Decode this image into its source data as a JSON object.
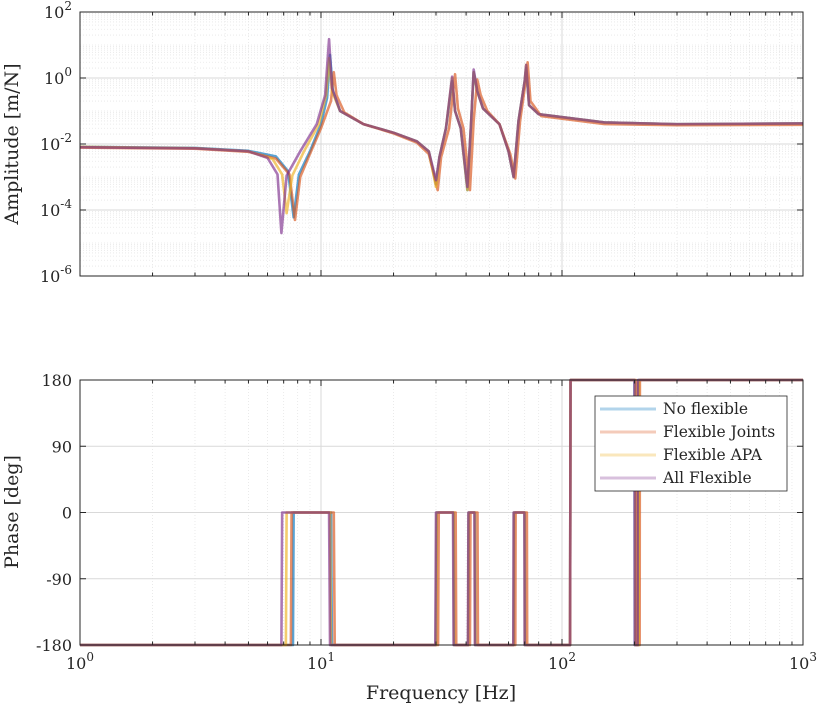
{
  "chart_data": [
    {
      "type": "line",
      "panel": "magnitude",
      "ylabel": "Amplitude [m/N]",
      "xlabel": "",
      "xscale": "log",
      "yscale": "log",
      "xlim": [
        1,
        1000
      ],
      "ylim": [
        1e-06,
        100
      ],
      "grid": true,
      "y_tick_labels": [
        {
          "base": "10",
          "exp": "2"
        },
        {
          "base": "10",
          "exp": "0"
        },
        {
          "base": "10",
          "exp": "-2"
        },
        {
          "base": "10",
          "exp": "-4"
        },
        {
          "base": "10",
          "exp": "-6"
        }
      ],
      "series": [
        {
          "name": "No flexible",
          "color": "#0072BD",
          "points": [
            [
              1,
              0.0082
            ],
            [
              3,
              0.0076
            ],
            [
              5,
              0.0062
            ],
            [
              6.5,
              0.0042
            ],
            [
              7.3,
              0.0015
            ],
            [
              7.7,
              6e-05
            ],
            [
              8.1,
              0.0012
            ],
            [
              9,
              0.006
            ],
            [
              10,
              0.04
            ],
            [
              10.6,
              0.25
            ],
            [
              10.9,
              5
            ],
            [
              11.2,
              0.4
            ],
            [
              12,
              0.1
            ],
            [
              15,
              0.04
            ],
            [
              20,
              0.022
            ],
            [
              25,
              0.012
            ],
            [
              28,
              0.006
            ],
            [
              30,
              0.0006
            ],
            [
              31,
              0.004
            ],
            [
              33,
              0.03
            ],
            [
              35,
              0.8
            ],
            [
              36,
              0.1
            ],
            [
              38,
              0.03
            ],
            [
              40.5,
              0.0004
            ],
            [
              42,
              0.05
            ],
            [
              43,
              1.5
            ],
            [
              44.5,
              0.4
            ],
            [
              47,
              0.12
            ],
            [
              55,
              0.04
            ],
            [
              60,
              0.006
            ],
            [
              63,
              0.001
            ],
            [
              66,
              0.05
            ],
            [
              70,
              0.8
            ],
            [
              71,
              2
            ],
            [
              73,
              0.15
            ],
            [
              80,
              0.08
            ],
            [
              150,
              0.045
            ],
            [
              300,
              0.04
            ],
            [
              1000,
              0.042
            ]
          ]
        },
        {
          "name": "Flexible Joints",
          "color": "#D95319",
          "points": [
            [
              1,
              0.0078
            ],
            [
              3,
              0.0072
            ],
            [
              5,
              0.0058
            ],
            [
              6.5,
              0.0036
            ],
            [
              7.4,
              0.0012
            ],
            [
              7.8,
              5e-05
            ],
            [
              8.2,
              0.001
            ],
            [
              9,
              0.005
            ],
            [
              10,
              0.03
            ],
            [
              11,
              0.2
            ],
            [
              11.3,
              1.5
            ],
            [
              11.6,
              0.3
            ],
            [
              12.5,
              0.09
            ],
            [
              15,
              0.04
            ],
            [
              20,
              0.021
            ],
            [
              25,
              0.011
            ],
            [
              28,
              0.005
            ],
            [
              30.5,
              0.0004
            ],
            [
              31.5,
              0.004
            ],
            [
              34,
              0.03
            ],
            [
              36,
              1.3
            ],
            [
              37,
              0.12
            ],
            [
              39,
              0.03
            ],
            [
              41.5,
              0.0004
            ],
            [
              43,
              0.05
            ],
            [
              44.5,
              0.9
            ],
            [
              46,
              0.3
            ],
            [
              49,
              0.1
            ],
            [
              55,
              0.04
            ],
            [
              61,
              0.005
            ],
            [
              64,
              0.0009
            ],
            [
              67,
              0.05
            ],
            [
              71,
              1
            ],
            [
              72,
              3
            ],
            [
              74,
              0.2
            ],
            [
              82,
              0.07
            ],
            [
              150,
              0.04
            ],
            [
              300,
              0.037
            ],
            [
              1000,
              0.038
            ]
          ]
        },
        {
          "name": "Flexible APA",
          "color": "#EDB120",
          "points": [
            [
              1,
              0.0082
            ],
            [
              3,
              0.0075
            ],
            [
              5,
              0.006
            ],
            [
              6.3,
              0.0035
            ],
            [
              6.9,
              0.0012
            ],
            [
              7.2,
              8e-05
            ],
            [
              7.6,
              0.0011
            ],
            [
              8.5,
              0.006
            ],
            [
              9.8,
              0.04
            ],
            [
              10.5,
              0.3
            ],
            [
              10.8,
              4
            ],
            [
              11.1,
              0.4
            ],
            [
              12,
              0.1
            ],
            [
              15,
              0.04
            ],
            [
              20,
              0.022
            ],
            [
              25,
              0.012
            ],
            [
              28,
              0.006
            ],
            [
              30,
              0.0005
            ],
            [
              31,
              0.004
            ],
            [
              33,
              0.03
            ],
            [
              35,
              1
            ],
            [
              36,
              0.1
            ],
            [
              38,
              0.03
            ],
            [
              40.5,
              0.0004
            ],
            [
              42,
              0.05
            ],
            [
              43,
              1.5
            ],
            [
              44.5,
              0.4
            ],
            [
              47,
              0.12
            ],
            [
              55,
              0.04
            ],
            [
              60,
              0.006
            ],
            [
              63,
              0.001
            ],
            [
              66,
              0.05
            ],
            [
              70,
              0.8
            ],
            [
              71,
              2.5
            ],
            [
              73,
              0.15
            ],
            [
              80,
              0.08
            ],
            [
              150,
              0.045
            ],
            [
              300,
              0.04
            ],
            [
              1000,
              0.042
            ]
          ]
        },
        {
          "name": "All Flexible",
          "color": "#7E2F8E",
          "points": [
            [
              1,
              0.008
            ],
            [
              3,
              0.0074
            ],
            [
              5,
              0.006
            ],
            [
              6,
              0.0038
            ],
            [
              6.6,
              0.0012
            ],
            [
              6.85,
              2e-05
            ],
            [
              7.2,
              0.0011
            ],
            [
              8.2,
              0.006
            ],
            [
              9.6,
              0.04
            ],
            [
              10.4,
              0.3
            ],
            [
              10.8,
              15
            ],
            [
              11.1,
              0.5
            ],
            [
              12,
              0.1
            ],
            [
              15,
              0.04
            ],
            [
              20,
              0.022
            ],
            [
              25,
              0.012
            ],
            [
              28,
              0.006
            ],
            [
              30,
              0.0008
            ],
            [
              31,
              0.004
            ],
            [
              33,
              0.03
            ],
            [
              35,
              1.1
            ],
            [
              36,
              0.1
            ],
            [
              38,
              0.03
            ],
            [
              40.5,
              0.0005
            ],
            [
              42,
              0.05
            ],
            [
              43,
              1.8
            ],
            [
              44.5,
              0.4
            ],
            [
              47,
              0.12
            ],
            [
              55,
              0.04
            ],
            [
              60,
              0.006
            ],
            [
              63,
              0.001
            ],
            [
              66,
              0.05
            ],
            [
              70,
              0.8
            ],
            [
              71,
              2.5
            ],
            [
              73,
              0.15
            ],
            [
              80,
              0.08
            ],
            [
              150,
              0.045
            ],
            [
              300,
              0.04
            ],
            [
              1000,
              0.042
            ]
          ]
        }
      ]
    },
    {
      "type": "line",
      "panel": "phase",
      "ylabel": "Phase [deg]",
      "xlabel": "Frequency [Hz]",
      "xscale": "log",
      "xlim": [
        1,
        1000
      ],
      "ylim": [
        -180,
        180
      ],
      "yticks": [
        180,
        90,
        0,
        -90,
        -180
      ],
      "y_tick_labels": [
        "180",
        "90",
        "0",
        "-90",
        "-180"
      ],
      "x_tick_labels": [
        {
          "base": "10",
          "exp": "0"
        },
        {
          "base": "10",
          "exp": "1"
        },
        {
          "base": "10",
          "exp": "2"
        },
        {
          "base": "10",
          "exp": "3"
        }
      ],
      "grid": true,
      "legend": "top-right",
      "series": [
        {
          "name": "No flexible",
          "color": "#0072BD",
          "points": [
            [
              1,
              -180
            ],
            [
              7.65,
              -180
            ],
            [
              7.7,
              0
            ],
            [
              11,
              0
            ],
            [
              11.1,
              -180
            ],
            [
              30,
              -180
            ],
            [
              30.2,
              0
            ],
            [
              35.5,
              0
            ],
            [
              35.7,
              -180
            ],
            [
              40.8,
              -180
            ],
            [
              41,
              0
            ],
            [
              43.5,
              0
            ],
            [
              43.7,
              -180
            ],
            [
              63,
              -180
            ],
            [
              63.2,
              0
            ],
            [
              70,
              0
            ],
            [
              70.2,
              -180
            ],
            [
              108,
              -180
            ],
            [
              108.5,
              180
            ],
            [
              200,
              180
            ],
            [
              200.5,
              -180
            ],
            [
              207,
              -180
            ],
            [
              207.5,
              180
            ],
            [
              1000,
              180
            ]
          ]
        },
        {
          "name": "Flexible Joints",
          "color": "#D95319",
          "points": [
            [
              1,
              -180
            ],
            [
              7.5,
              -180
            ],
            [
              7.55,
              0
            ],
            [
              11.3,
              0
            ],
            [
              11.4,
              -180
            ],
            [
              30.6,
              -180
            ],
            [
              30.8,
              0
            ],
            [
              36.2,
              0
            ],
            [
              36.4,
              -180
            ],
            [
              41.5,
              -180
            ],
            [
              41.7,
              0
            ],
            [
              44.6,
              0
            ],
            [
              44.8,
              -180
            ],
            [
              64,
              -180
            ],
            [
              64.2,
              0
            ],
            [
              71.5,
              0
            ],
            [
              71.7,
              -180
            ],
            [
              108,
              -180
            ],
            [
              108.5,
              180
            ],
            [
              203,
              180
            ],
            [
              203.5,
              -180
            ],
            [
              210,
              -180
            ],
            [
              210.5,
              180
            ],
            [
              1000,
              180
            ]
          ]
        },
        {
          "name": "Flexible APA",
          "color": "#EDB120",
          "points": [
            [
              1,
              -180
            ],
            [
              7.15,
              -180
            ],
            [
              7.2,
              0
            ],
            [
              10.9,
              0
            ],
            [
              11,
              -180
            ],
            [
              30,
              -180
            ],
            [
              30.2,
              0
            ],
            [
              35.5,
              0
            ],
            [
              35.7,
              -180
            ],
            [
              40.8,
              -180
            ],
            [
              41,
              0
            ],
            [
              43.5,
              0
            ],
            [
              43.7,
              -180
            ],
            [
              63,
              -180
            ],
            [
              63.2,
              0
            ],
            [
              70,
              0
            ],
            [
              70.2,
              -180
            ],
            [
              108,
              -180
            ],
            [
              108.5,
              180
            ],
            [
              201,
              180
            ],
            [
              201.5,
              -180
            ],
            [
              208,
              -180
            ],
            [
              208.5,
              180
            ],
            [
              1000,
              180
            ]
          ]
        },
        {
          "name": "All Flexible",
          "color": "#7E2F8E",
          "points": [
            [
              1,
              -180
            ],
            [
              6.85,
              -180
            ],
            [
              6.9,
              0
            ],
            [
              10.8,
              0
            ],
            [
              10.9,
              -180
            ],
            [
              29.8,
              -180
            ],
            [
              30,
              0
            ],
            [
              35.3,
              0
            ],
            [
              35.5,
              -180
            ],
            [
              40.7,
              -180
            ],
            [
              40.9,
              0
            ],
            [
              43.3,
              0
            ],
            [
              43.5,
              -180
            ],
            [
              62.8,
              -180
            ],
            [
              63,
              0
            ],
            [
              69.8,
              0
            ],
            [
              70,
              -180
            ],
            [
              108,
              -180
            ],
            [
              108.5,
              180
            ],
            [
              200,
              180
            ],
            [
              200.5,
              -180
            ],
            [
              206,
              -180
            ],
            [
              206.5,
              180
            ],
            [
              1000,
              180
            ]
          ]
        }
      ]
    }
  ]
}
